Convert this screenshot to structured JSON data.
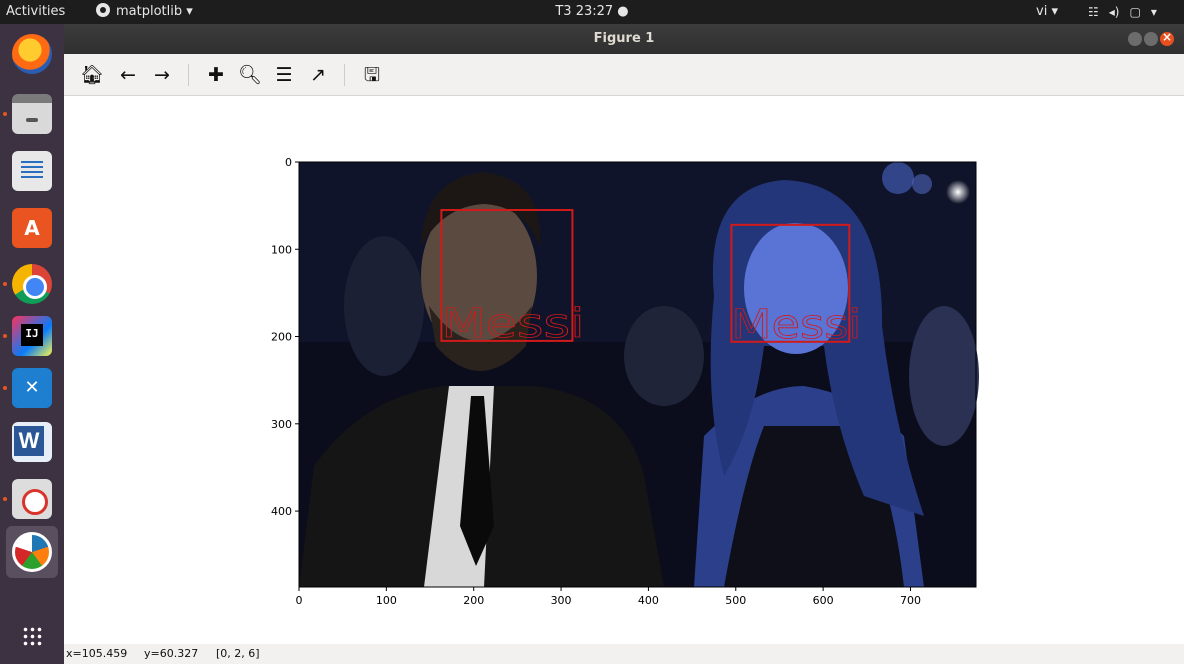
{
  "topbar": {
    "activities": "Activities",
    "app_name": "matplotlib ▾",
    "clock": "T3 23:27 ●",
    "language": "vi ▾",
    "tray_icons": [
      "network-icon",
      "volume-icon",
      "power-icon",
      "system-menu-icon"
    ]
  },
  "launcher": {
    "apps": [
      "Firefox",
      "Files",
      "LibreOffice Writer",
      "Ubuntu Software",
      "Google Chrome",
      "IntelliJ IDEA",
      "Visual Studio Code",
      "Word",
      "Screenshot",
      "matplotlib"
    ]
  },
  "window": {
    "title": "Figure 1"
  },
  "toolbar": {
    "icons": [
      "home-icon",
      "back-arrow-icon",
      "forward-arrow-icon",
      "pan-move-icon",
      "zoom-icon",
      "subplots-configure-icon",
      "edit-axis-icon",
      "save-icon"
    ]
  },
  "plot": {
    "x_ticks": [
      "0",
      "100",
      "200",
      "300",
      "400",
      "500",
      "600",
      "700"
    ],
    "y_ticks": [
      "0",
      "100",
      "200",
      "300",
      "400"
    ],
    "x_range": [
      0,
      775
    ],
    "y_range": [
      0,
      487
    ],
    "detections": [
      {
        "label": "Messi",
        "x0": 163,
        "y0": 55,
        "x1": 313,
        "y1": 205
      },
      {
        "label": "Messi",
        "x0": 495,
        "y0": 72,
        "x1": 630,
        "y1": 206
      }
    ],
    "box_color": "#d11a1a"
  },
  "status": {
    "x_readout": "x=105.459",
    "y_readout": "y=60.327",
    "pixel_value": "[0, 2, 6]"
  }
}
